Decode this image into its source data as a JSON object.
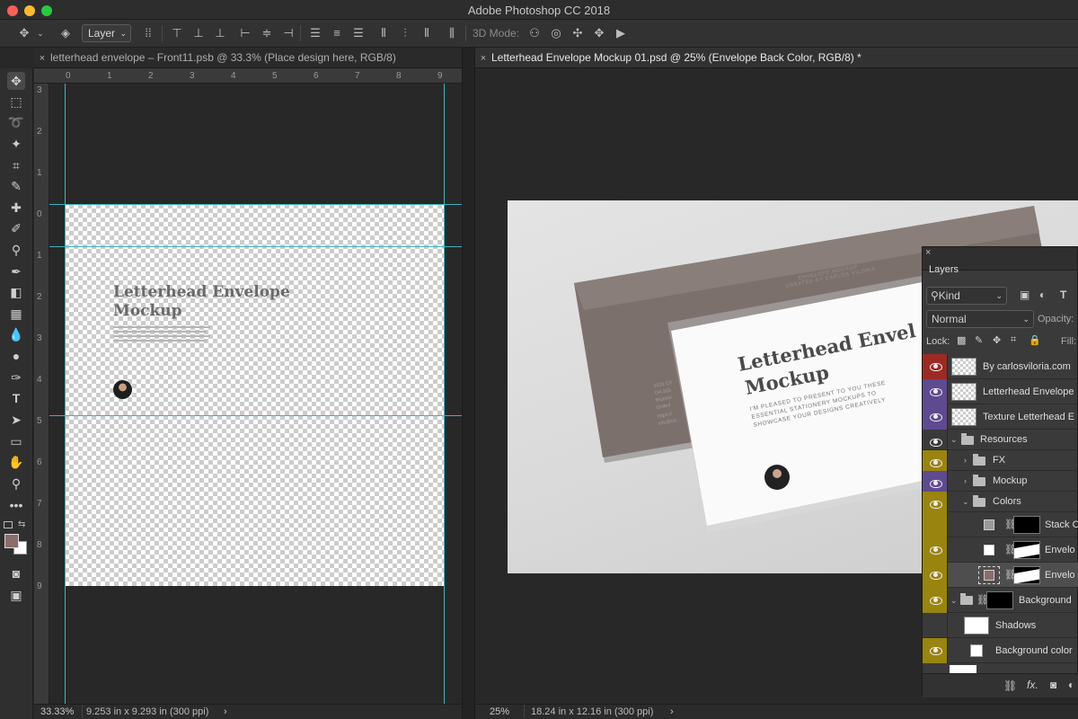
{
  "app": {
    "title": "Adobe Photoshop CC 2018"
  },
  "colors": {
    "guide": "#3fb3bd",
    "foreground": "#8b6d69",
    "background": "#ffffff",
    "red_label": "#9b2a24",
    "violet_label": "#5e4a8f",
    "yellow_label": "#9a8410"
  },
  "options_bar": {
    "auto_select_target": "Layer",
    "three_d_mode_label": "3D Mode:"
  },
  "tabs": [
    {
      "label": "letterhead envelope – Front11.psb @ 33.3% (Place design here, RGB/8)",
      "close": "×"
    },
    {
      "label": "Letterhead Envelope Mockup 01.psd @ 25% (Envelope Back Color, RGB/8) *",
      "close": "×"
    }
  ],
  "ruler_h": [
    "0",
    "1",
    "2",
    "3",
    "4",
    "5",
    "6",
    "7",
    "8",
    "9"
  ],
  "ruler_v": [
    "3",
    "2",
    "1",
    "0",
    "1",
    "2",
    "3",
    "4",
    "5",
    "6",
    "7",
    "8",
    "9"
  ],
  "canvas1": {
    "title": "Letterhead Envelope\nMockup"
  },
  "photo": {
    "front_title": "Letterhead Envel\nMockup",
    "front_lines": [
      "I'M PLEASED TO PRESENT TO YOU THESE",
      "ESSENTIAL STATIONERY MOCKUPS TO",
      "SHOWCASE YOUR DESIGNS CREATIVELY"
    ],
    "back_lines": [
      "ENVELOPE MOCKUP",
      "CREATED BY CARLOS VILORIA"
    ],
    "side_text": [
      "9131 Ch",
      "GA 315",
      "Brunsw",
      "United",
      "https://",
      "info@ca"
    ]
  },
  "layers_panel": {
    "title": "Layers",
    "filter": "Kind",
    "blend_mode": "Normal",
    "opacity_label": "Opacity:",
    "lock_label": "Lock:",
    "fill_label": "Fill:",
    "close": "×",
    "fx_label": "fx.",
    "layers": [
      {
        "name": "By carlosviloria.com",
        "visible": true,
        "label_color": "red",
        "kind": "layer"
      },
      {
        "name": "Letterhead Envelope",
        "visible": true,
        "label_color": "violet",
        "kind": "smart"
      },
      {
        "name": "Texture Letterhead E",
        "visible": true,
        "label_color": "violet",
        "kind": "smart"
      },
      {
        "name": "Resources",
        "visible": true,
        "label_color": "none",
        "kind": "group-open"
      },
      {
        "name": "FX",
        "visible": true,
        "label_color": "yellow",
        "kind": "group-closed"
      },
      {
        "name": "Mockup",
        "visible": true,
        "label_color": "violet",
        "kind": "group-closed"
      },
      {
        "name": "Colors",
        "visible": true,
        "label_color": "yellow",
        "kind": "group-open"
      },
      {
        "name": "Stack C",
        "visible": false,
        "label_color": "yellow",
        "kind": "fill-mask"
      },
      {
        "name": "Envelo",
        "visible": true,
        "label_color": "yellow",
        "kind": "fill-mask"
      },
      {
        "name": "Envelo",
        "visible": true,
        "label_color": "yellow",
        "kind": "fill-mask-selected"
      },
      {
        "name": "Background",
        "visible": true,
        "label_color": "yellow",
        "kind": "group-mask"
      },
      {
        "name": "Shadows",
        "visible": true,
        "label_color": "none",
        "kind": "layer"
      },
      {
        "name": "Background color",
        "visible": true,
        "label_color": "yellow",
        "kind": "fill"
      }
    ]
  },
  "status_left": {
    "zoom": "33.33%",
    "info": "9.253 in x 9.293 in (300 ppi)",
    "arrow": "›"
  },
  "status_right": {
    "zoom": "25%",
    "info": "18.24 in x 12.16 in (300 ppi)",
    "arrow": "›"
  }
}
